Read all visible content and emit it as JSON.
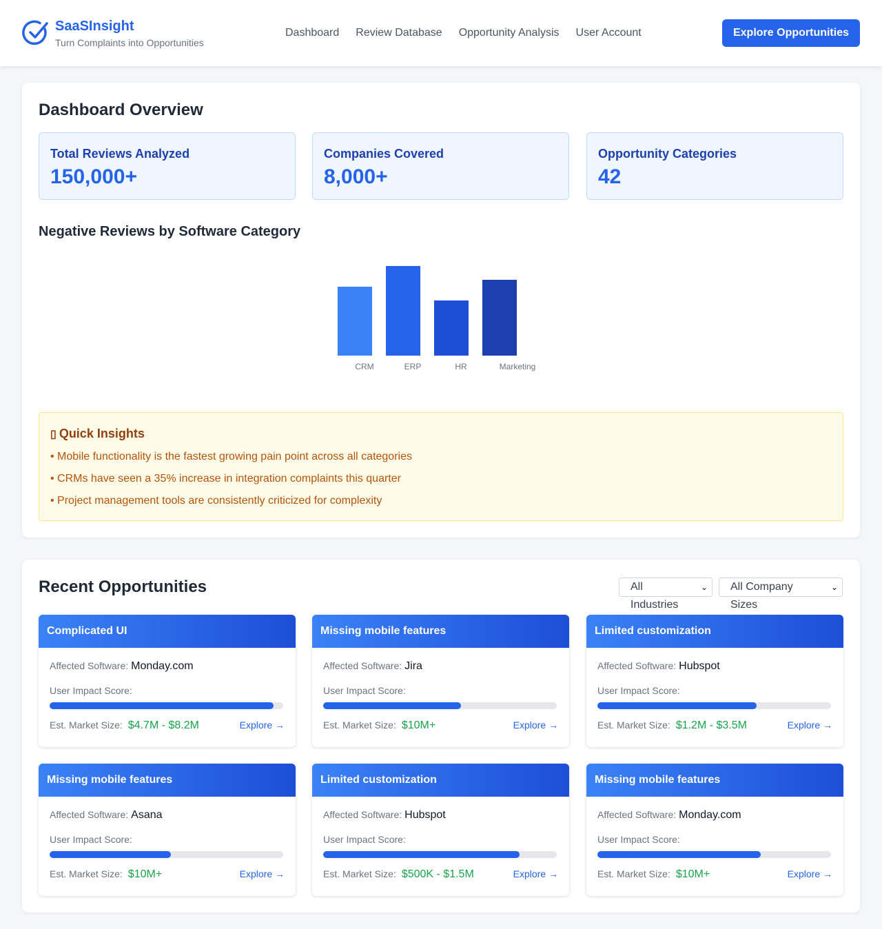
{
  "header": {
    "brand": "SaaSInsight",
    "tagline": "Turn Complaints into Opportunities",
    "logo_icon": "check-circle-icon",
    "nav": [
      "Dashboard",
      "Review Database",
      "Opportunity Analysis",
      "User Account"
    ],
    "cta": "Explore Opportunities",
    "accent": "#2563eb"
  },
  "overview": {
    "title": "Dashboard Overview",
    "stats": [
      {
        "label": "Total Reviews Analyzed",
        "value": "150,000+"
      },
      {
        "label": "Companies Covered",
        "value": "8,000+"
      },
      {
        "label": "Opportunity Categories",
        "value": "42"
      }
    ],
    "chart_title": "Negative Reviews by Software Category"
  },
  "chart_data": {
    "type": "bar",
    "categories": [
      "CRM",
      "ERP",
      "HR",
      "Marketing"
    ],
    "values": [
      100,
      130,
      80,
      110
    ],
    "colors": [
      "#3b82f6",
      "#2563eb",
      "#1d4ed8",
      "#1e40af"
    ],
    "ylim": [
      0,
      130
    ],
    "grid": false,
    "title": "Negative Reviews by Software Category"
  },
  "insights": {
    "icon": "lightbulb-icon",
    "title": "Quick Insights",
    "items": [
      "• Mobile functionality is the fastest growing pain point across all categories",
      "• CRMs have seen a 35% increase in integration complaints this quarter",
      "• Project management tools are consistently criticized for complexity"
    ]
  },
  "opportunities": {
    "title": "Recent Opportunities",
    "filters": {
      "industry": "All Industries",
      "size": "All Company Sizes"
    },
    "labels": {
      "software": "Affected Software:",
      "impact": "User Impact Score:",
      "market": "Est. Market Size:",
      "explore": "Explore →"
    },
    "cards": [
      {
        "title": "Complicated UI",
        "software": "Monday.com",
        "impact": 0.96,
        "market": "$4.7M - $8.2M"
      },
      {
        "title": "Missing mobile features",
        "software": "Jira",
        "impact": 0.59,
        "market": "$10M+"
      },
      {
        "title": "Limited customization",
        "software": "Hubspot",
        "impact": 0.68,
        "market": "$1.2M - $3.5M"
      },
      {
        "title": "Missing mobile features",
        "software": "Asana",
        "impact": 0.52,
        "market": "$10M+"
      },
      {
        "title": "Limited customization",
        "software": "Hubspot",
        "impact": 0.84,
        "market": "$500K - $1.5M"
      },
      {
        "title": "Missing mobile features",
        "software": "Monday.com",
        "impact": 0.7,
        "market": "$10M+"
      }
    ]
  }
}
